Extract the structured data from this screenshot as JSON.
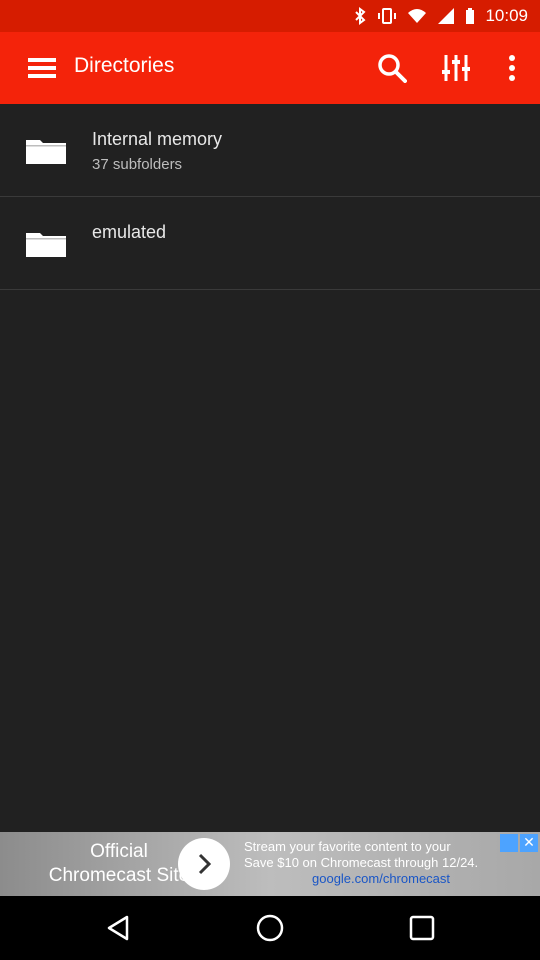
{
  "status": {
    "time": "10:09"
  },
  "toolbar": {
    "title": "Directories",
    "icons": [
      "menu-icon",
      "search-icon",
      "equalizer-icon",
      "more-vert-icon"
    ]
  },
  "directories": [
    {
      "name": "Internal memory",
      "subtitle": "37 subfolders",
      "icon": "folder-icon"
    },
    {
      "name": "emulated",
      "subtitle": "",
      "icon": "folder-icon"
    }
  ],
  "ad": {
    "title": "Official Chromecast Site",
    "line1": "Stream your favorite content to your",
    "line2": "Save $10 on Chromecast through 12/24.",
    "link": "google.com/chromecast",
    "close": "✕"
  },
  "colors": {
    "toolbar": "#f4230a",
    "statusbar": "#d61c00",
    "background": "#212121"
  }
}
